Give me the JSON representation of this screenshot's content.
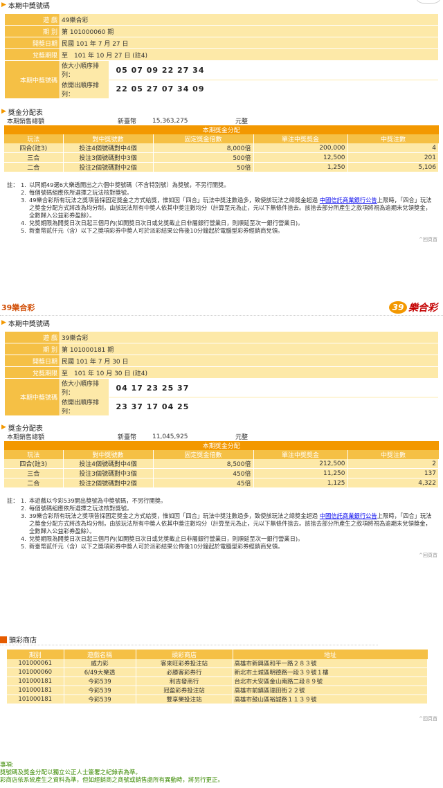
{
  "draw1": {
    "current_title": "本期中獎號碼",
    "labels": {
      "game": "遊 戲",
      "period": "期 別",
      "open_date": "開獎日期",
      "claim_period": "兌獎期限",
      "numbers": "本期中獎號碼"
    },
    "game": "49樂合彩",
    "period": "第 101000060 期",
    "open_date": "民國 101 年 7 月 27 日",
    "claim_period": "至　101 年 10 月 27 日 (註4)",
    "sorted_label": "依大小順序排列：",
    "sorted": "05 07 09 22 27 34",
    "drawn_label": "依開出順序排列：",
    "drawn": "22 05 27 07 34 09",
    "prize_title": "獎金分配表",
    "sales_label": "本期銷售總額",
    "currency": "新臺幣",
    "sales": "15,363,275",
    "unit": "元整",
    "prize_header": "本期獎金分配",
    "cols": [
      "玩法",
      "對中獎號數",
      "固定獎金倍數",
      "單注中獎獎金",
      "中獎注數"
    ],
    "rows": [
      {
        "play": "四合(註3)",
        "match": "投注4個號碼對中4個",
        "mult": "8,000倍",
        "prize": "200,000",
        "count": "4"
      },
      {
        "play": "三合",
        "match": "投注3個號碼對中3個",
        "mult": "500倍",
        "prize": "12,500",
        "count": "201"
      },
      {
        "play": "二合",
        "match": "投注2個號碼對中2個",
        "mult": "50倍",
        "prize": "1,250",
        "count": "5,106"
      }
    ],
    "note_prefix": "註：",
    "notes": [
      "以同期49選6大樂透開出之六個中獎號碼（不含特別號）為獎號，不另行開獎。",
      "每個號碼組應依所選擇之玩法核對獎號。",
      "49樂合彩所有玩法之獎項皆採固定獎金之方式給獎，惟如因「四合」玩法中獎注數過多，致使該玩法之總獎金超過",
      "兌獎期限為開獎日次日起三個月內(如開獎日次日或兌獎截止日非屬銀行營業日，則順延至次一銀行營業日)。",
      "新臺幣貳仟元（含）以下之獎項彩券中獎人可於派彩結果公佈後10分鐘起於電腦型彩券經銷商兌領。"
    ],
    "note3_link": "中國信託商業銀行公告",
    "note3_cont": "上限時，「四合」玩法之獎金分配方式將改為均分制，由該玩法所有中獎人依其中獎注數均分（計算至元為止，元以下無條件捨去。該捨去部分所產生之款項將視為逾期未兌領獎金，全數歸入公益彩券盈餘）。",
    "back_top": "^回頁首"
  },
  "draw2": {
    "brand": "39樂合彩",
    "logo_num": "39",
    "logo_text": "樂合彩",
    "current_title": "本期中獎號碼",
    "labels": {
      "game": "遊 戲",
      "period": "期 別",
      "open_date": "開獎日期",
      "claim_period": "兌獎期限",
      "numbers": "本期中獎號碼"
    },
    "game": "39樂合彩",
    "period": "第 101000181 期",
    "open_date": "民國 101 年 7 月 30 日",
    "claim_period": "至　101 年 10 月 30 日 (註4)",
    "sorted_label": "依大小順序排列：",
    "sorted": "04 17 23 25 37",
    "drawn_label": "依開出順序排列：",
    "drawn": "23 37 17 04 25",
    "prize_title": "獎金分配表",
    "sales_label": "本期銷售總額",
    "currency": "新臺幣",
    "sales": "11,045,925",
    "unit": "元整",
    "prize_header": "本期獎金分配",
    "cols": [
      "玩法",
      "對中獎號數",
      "固定獎金倍數",
      "單注中獎獎金",
      "中獎注數"
    ],
    "rows": [
      {
        "play": "四合(註3)",
        "match": "投注4個號碼對中4個",
        "mult": "8,500倍",
        "prize": "212,500",
        "count": "2"
      },
      {
        "play": "三合",
        "match": "投注3個號碼對中3個",
        "mult": "450倍",
        "prize": "11,250",
        "count": "137"
      },
      {
        "play": "二合",
        "match": "投注2個號碼對中2個",
        "mult": "45倍",
        "prize": "1,125",
        "count": "4,322"
      }
    ],
    "note_prefix": "註：",
    "notes": [
      "本遊戲以今彩539開出獎號為中獎號碼，不另行開獎。",
      "每個號碼組應依所選擇之玩法核對獎號。",
      "39樂合彩所有玩法之獎項皆採固定獎金之方式給獎，惟如因「四合」玩法中獎注數過多，致使該玩法之總獎金超過",
      "兌獎期限為開獎日次日起三個月內(如開獎日次日或兌獎截止日非屬銀行營業日，則順延至次一銀行營業日)。",
      "新臺幣貳仟元（含）以下之獎項彩券中獎人可於派彩結果公佈後10分鐘起於電腦型彩券經銷商兌領。"
    ],
    "note3_link": "中國信託商業銀行公告",
    "note3_cont": "上限時，「四合」玩法之獎金分配方式將改為均分制，由該玩法所有中獎人依其中獎注數均分（計算至元為止，元以下無條件捨去。該捨去部分所產生之款項將視為逾期未兌領獎金，全數歸入公益彩券盈餘）。",
    "back_top": "^回頁首"
  },
  "shops": {
    "title": "頭彩商店",
    "cols": [
      "期別",
      "遊戲名稱",
      "頭彩商店",
      "地址"
    ],
    "rows": [
      {
        "period": "101000061",
        "game": "威力彩",
        "store": "客來旺彩券投注站",
        "addr": "高雄市新興區和平一路２８３號"
      },
      {
        "period": "101000060",
        "game": "6/49大樂透",
        "store": "必勝客彩券行",
        "addr": "新北市土城區明德路一段３９號１樓"
      },
      {
        "period": "101000181",
        "game": "今彩539",
        "store": "利吉發商行",
        "addr": "台北市大安區金山南路二段８９號"
      },
      {
        "period": "101000181",
        "game": "今彩539",
        "store": "冠盈彩券投注站",
        "addr": "高雄市前鎮區瑞田街２２號"
      },
      {
        "period": "101000181",
        "game": "今彩539",
        "store": "雙享樂投注站",
        "addr": "高雄市鼓山區裕誠路１１３９號"
      }
    ],
    "back_top": "^回頁首"
  },
  "footer": {
    "l1": "事項:",
    "l2": "獎號碼及獎金分配以獨立公正人士簽署之紀錄表為準。",
    "l3": "彩商店依系統產生之資料為準，但如經銷商之商號或銷售處所有異動時，將另行更正。"
  }
}
